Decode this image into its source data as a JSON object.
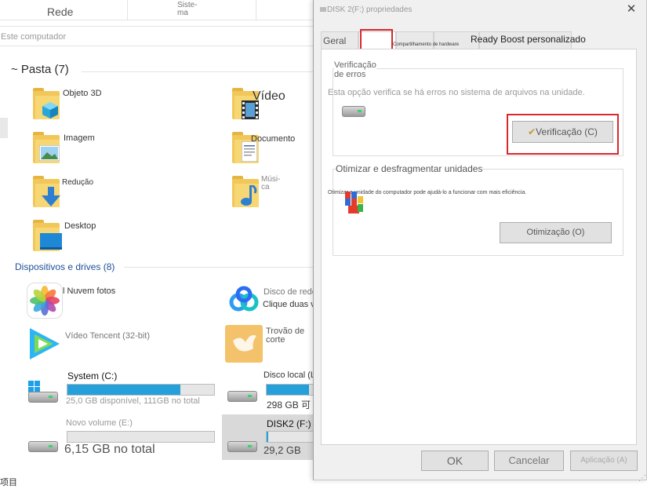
{
  "explorer": {
    "topbar": {
      "network_label": "Rede",
      "system_label": "Siste-\nma"
    },
    "address": {
      "text": "Este computador"
    },
    "folders_header": "~ Pasta (7)",
    "folders": [
      {
        "label": "Objeto 3D"
      },
      {
        "label": "Vídeo"
      },
      {
        "label": "Imagem"
      },
      {
        "label": "Documento"
      },
      {
        "label": "Redução"
      },
      {
        "label": "Músi-\nca"
      },
      {
        "label": "Desktop"
      }
    ],
    "devices_header": "Dispositivos e drives (8)",
    "devices": [
      {
        "label": "l Nuvem fotos"
      },
      {
        "label": "Disco de rede Baidu",
        "sublabel": "Clique duas vezes em run Hundred"
      },
      {
        "label": "Vídeo Tencent (32-bit)"
      },
      {
        "label": "Trovão de\ncorte"
      }
    ],
    "drives": [
      {
        "name": "System (C:)",
        "info": "25,0 GB disponível, 111GB no total",
        "usage": 0.77
      },
      {
        "name": "Disco local (L",
        "info": "298 GB 可",
        "usage": 0.9
      },
      {
        "name": "Novo volume (E:)",
        "info": "6,15 GB no total",
        "usage": 0.0
      },
      {
        "name": "DISK2 (F:)",
        "info": "29,2 GB",
        "usage": 0.04
      }
    ],
    "statusbar": {
      "text": "项目"
    },
    "accent_color": "#26a0da"
  },
  "dialog": {
    "title": "DISK 2(F:) propriedades",
    "close_icon": "close-icon",
    "tabs": [
      {
        "label": "Geral"
      },
      {
        "label": ""
      },
      {
        "label": ""
      },
      {
        "label": "Compartilhamento de hardware"
      },
      {
        "label": "Ready Boost personalizado"
      }
    ],
    "error_check": {
      "title": "Verificação\nde erros",
      "description": "Esta opção verifica se há erros no sistema de arquivos na unidade.",
      "button": "Verificação (C)"
    },
    "optimize": {
      "title": "Otimizar e desfragmentar unidades",
      "description": "Otimizar a unidade do computador pode ajudá-lo a funcionar com mais eficiência.",
      "button": "Otimização (O)"
    },
    "footer": {
      "ok": "OK",
      "cancel": "Cancelar",
      "apply": "Aplicação (A)"
    },
    "highlight_color": "#d9272e"
  }
}
